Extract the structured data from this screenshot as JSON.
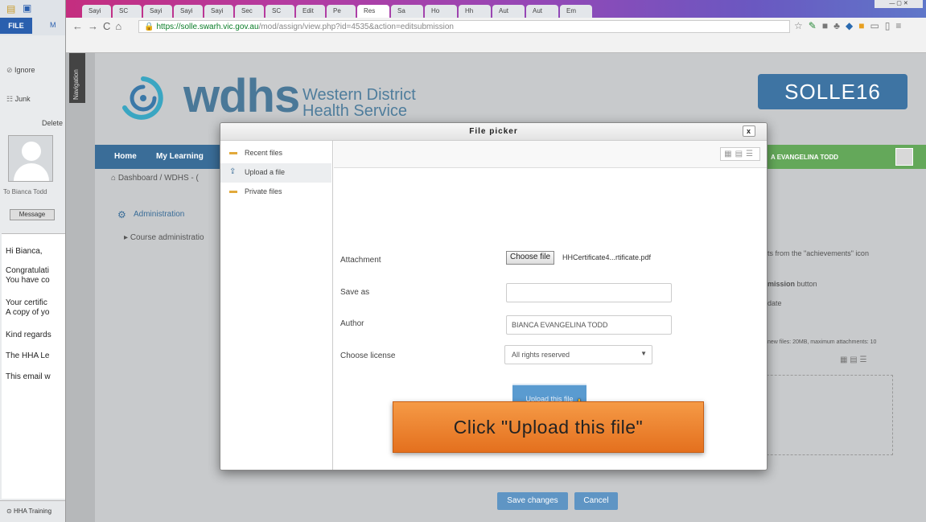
{
  "outlook": {
    "file_tab": "FILE",
    "me_tab": "M",
    "ignore": "Ignore",
    "junk": "Junk",
    "delete": "Delete",
    "to_label": "To  Bianca Todd",
    "message_btn": "Message",
    "lines": [
      "Hi Bianca,",
      "Congratulati",
      "You have co",
      "Your certific",
      "A copy of yo",
      "Kind regards",
      "The HHA Le",
      "This email w"
    ],
    "footer": "HHA Training"
  },
  "browser": {
    "tabs": [
      "Sayi",
      "SC",
      "Sayi",
      "Sayi",
      "Sayi",
      "Sec",
      "SC",
      "Edit",
      "Pe",
      "Res",
      "Sa",
      "Ho",
      "Hh",
      "Aut",
      "Aut",
      "Em"
    ],
    "url_host": "https://solle.swarh.vic.gov.au",
    "url_path": "/mod/assign/view.php?id=4535&action=editsubmission"
  },
  "site": {
    "nav_tab": "Navigation",
    "logo_main": "wdhs",
    "logo_sub1": "Western District",
    "logo_sub2": "Health Service",
    "badge": "SOLLE16",
    "nav_home": "Home",
    "nav_learning": "My Learning",
    "user_name": "A EVANGELINA TODD",
    "breadcrumb": "Dashboard / WDHS - (",
    "admin_title": "Administration",
    "admin_course": "Course administratio",
    "right_text1": "ts from the \"achievements\" icon",
    "right_text2": "mission",
    "right_text2b": " button",
    "right_text3": "date",
    "right_text4": "new files: 20MB, maximum attachments: 10",
    "save_changes": "Save changes",
    "cancel": "Cancel"
  },
  "modal": {
    "title": "File picker",
    "close": "x",
    "sidebar": [
      {
        "label": "Recent files",
        "icon": "folder-icon"
      },
      {
        "label": "Upload a file",
        "icon": "upload-icon"
      },
      {
        "label": "Private files",
        "icon": "folder-icon"
      }
    ],
    "attachment_label": "Attachment",
    "choose_file": "Choose file",
    "chosen_file": "HHCertificate4...rtificate.pdf",
    "save_as_label": "Save as",
    "save_as_value": "",
    "author_label": "Author",
    "author_value": "BIANCA EVANGELINA TODD",
    "license_label": "Choose license",
    "license_value": "All rights reserved",
    "upload_button": "Upload this file"
  },
  "callout": "Click \"Upload this file\"",
  "colors": {
    "accent": "#3a6d98",
    "user_bar": "#64a85a",
    "callout": "#ef8a34",
    "upload_btn": "#5a9bd0"
  }
}
